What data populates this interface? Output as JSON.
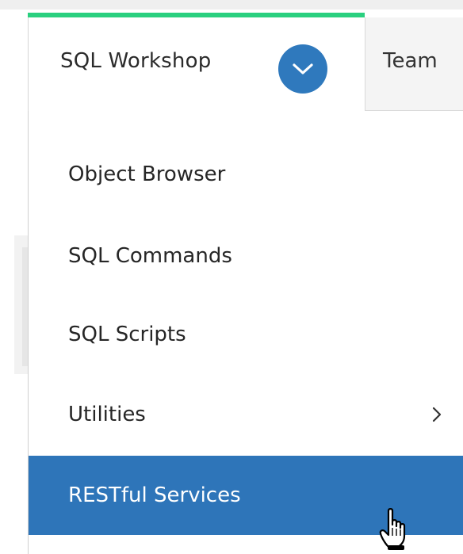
{
  "nav": {
    "active_tab": {
      "label": "SQL Workshop",
      "toggle_icon": "chevron-down-icon",
      "indicator_color": "#2ad07f",
      "toggle_color": "#2f79bd"
    },
    "next_tab": {
      "label": "Team"
    }
  },
  "menu": {
    "items": [
      {
        "label": "Object Browser"
      },
      {
        "label": "SQL Commands"
      },
      {
        "label": "SQL Scripts"
      },
      {
        "label": "Utilities",
        "has_submenu": true,
        "submenu_icon": "chevron-right-icon"
      },
      {
        "label": "RESTful Services",
        "highlighted": true
      }
    ],
    "highlight_color": "#2e75b9"
  },
  "cursor": {
    "type": "hand-pointer-icon"
  }
}
